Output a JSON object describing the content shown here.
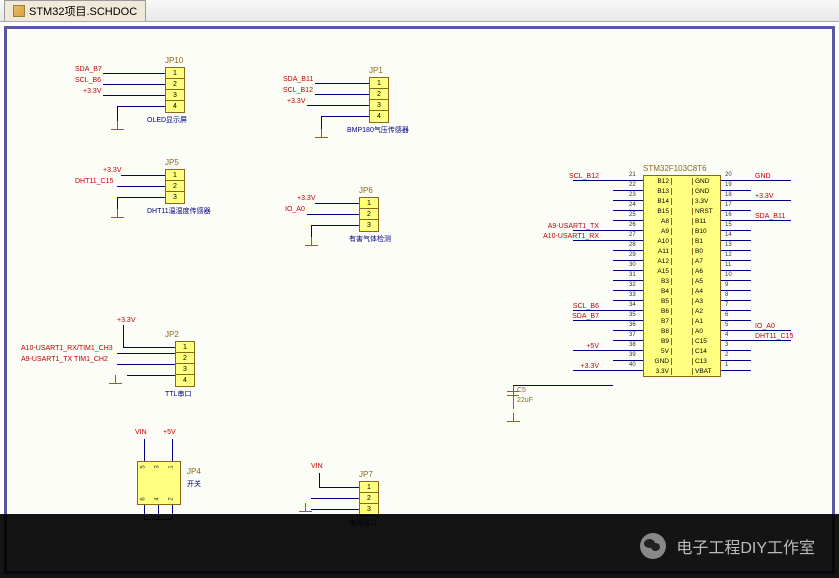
{
  "tab": {
    "title": "STM32项目.SCHDOC"
  },
  "connectors": {
    "jp10": {
      "ref": "JP10",
      "pins": [
        "1",
        "2",
        "3",
        "4"
      ],
      "desc": "OLED显示屏",
      "nets": [
        "SDA_B7",
        "SCL_B6",
        "+3.3V"
      ]
    },
    "jp1": {
      "ref": "JP1",
      "pins": [
        "1",
        "2",
        "3",
        "4"
      ],
      "desc": "BMP180气压传感器",
      "nets": [
        "SDA_B11",
        "SCL_B12",
        "+3.3V"
      ]
    },
    "jp5": {
      "ref": "JP5",
      "pins": [
        "1",
        "2",
        "3"
      ],
      "desc": "DHT11温湿度传感器",
      "nets": [
        "+3.3V",
        "DHT11_C15"
      ]
    },
    "jp6": {
      "ref": "JP6",
      "pins": [
        "1",
        "2",
        "3"
      ],
      "desc": "有害气体检测",
      "nets": [
        "+3.3V",
        "IO_A0"
      ]
    },
    "jp2": {
      "ref": "JP2",
      "pins": [
        "1",
        "2",
        "3",
        "4"
      ],
      "desc": "TTL串口",
      "nets": [
        "+3.3V",
        "A10-USART1_RX/TIM1_CH3",
        "A9-USART1_TX TIM1_CH2"
      ]
    },
    "jp4": {
      "ref": "JP4",
      "desc": "开关",
      "pins": [
        "1",
        "2",
        "3",
        "4",
        "5",
        "6"
      ],
      "nets": [
        "VIN",
        "+5V"
      ]
    },
    "jp7": {
      "ref": "JP7",
      "pins": [
        "1",
        "2",
        "3"
      ],
      "desc": "电源接口",
      "nets": [
        "VIN"
      ]
    }
  },
  "chip": {
    "ref": "STM32F103C8T6",
    "left_pins": [
      {
        "n": "21",
        "name": "B12"
      },
      {
        "n": "22",
        "name": "B13"
      },
      {
        "n": "23",
        "name": "B14"
      },
      {
        "n": "24",
        "name": "B15"
      },
      {
        "n": "25",
        "name": "A8"
      },
      {
        "n": "26",
        "name": "A9"
      },
      {
        "n": "27",
        "name": "A10"
      },
      {
        "n": "28",
        "name": "A11"
      },
      {
        "n": "29",
        "name": "A12"
      },
      {
        "n": "30",
        "name": "A15"
      },
      {
        "n": "31",
        "name": "B3"
      },
      {
        "n": "32",
        "name": "B4"
      },
      {
        "n": "33",
        "name": "B5"
      },
      {
        "n": "34",
        "name": "B6"
      },
      {
        "n": "35",
        "name": "B7"
      },
      {
        "n": "36",
        "name": "B8"
      },
      {
        "n": "37",
        "name": "B9"
      },
      {
        "n": "38",
        "name": "5V"
      },
      {
        "n": "39",
        "name": "GND"
      },
      {
        "n": "40",
        "name": "3.3V"
      }
    ],
    "right_pins": [
      {
        "n": "20",
        "name": "GND"
      },
      {
        "n": "19",
        "name": "GND"
      },
      {
        "n": "18",
        "name": "3.3V"
      },
      {
        "n": "17",
        "name": "NRST"
      },
      {
        "n": "16",
        "name": "B11"
      },
      {
        "n": "15",
        "name": "B10"
      },
      {
        "n": "14",
        "name": "B1"
      },
      {
        "n": "13",
        "name": "B0"
      },
      {
        "n": "12",
        "name": "A7"
      },
      {
        "n": "11",
        "name": "A6"
      },
      {
        "n": "10",
        "name": "A5"
      },
      {
        "n": "9",
        "name": "A4"
      },
      {
        "n": "8",
        "name": "A3"
      },
      {
        "n": "7",
        "name": "A2"
      },
      {
        "n": "6",
        "name": "A1"
      },
      {
        "n": "5",
        "name": "A0"
      },
      {
        "n": "4",
        "name": "C15"
      },
      {
        "n": "3",
        "name": "C14"
      },
      {
        "n": "2",
        "name": "C13"
      },
      {
        "n": "1",
        "name": "VBAT"
      }
    ],
    "left_nets": [
      "SCL_B12",
      "",
      "",
      "",
      "",
      "A9-USART1_TX",
      "A10-USART1_RX",
      "",
      "",
      "",
      "",
      "",
      "",
      "SCL_B6",
      "SDA_B7",
      "",
      "",
      "+5V",
      "",
      "+3.3V"
    ],
    "right_nets": [
      "GND",
      "",
      "+3.3V",
      "",
      "SDA_B11",
      "",
      "",
      "",
      "",
      "",
      "",
      "",
      "",
      "",
      "",
      "IO_A0",
      "DHT11_C15",
      "",
      "",
      ""
    ]
  },
  "cap": {
    "ref": "C5",
    "val": "22uF"
  },
  "footer": {
    "text": "电子工程DIY工作室"
  }
}
